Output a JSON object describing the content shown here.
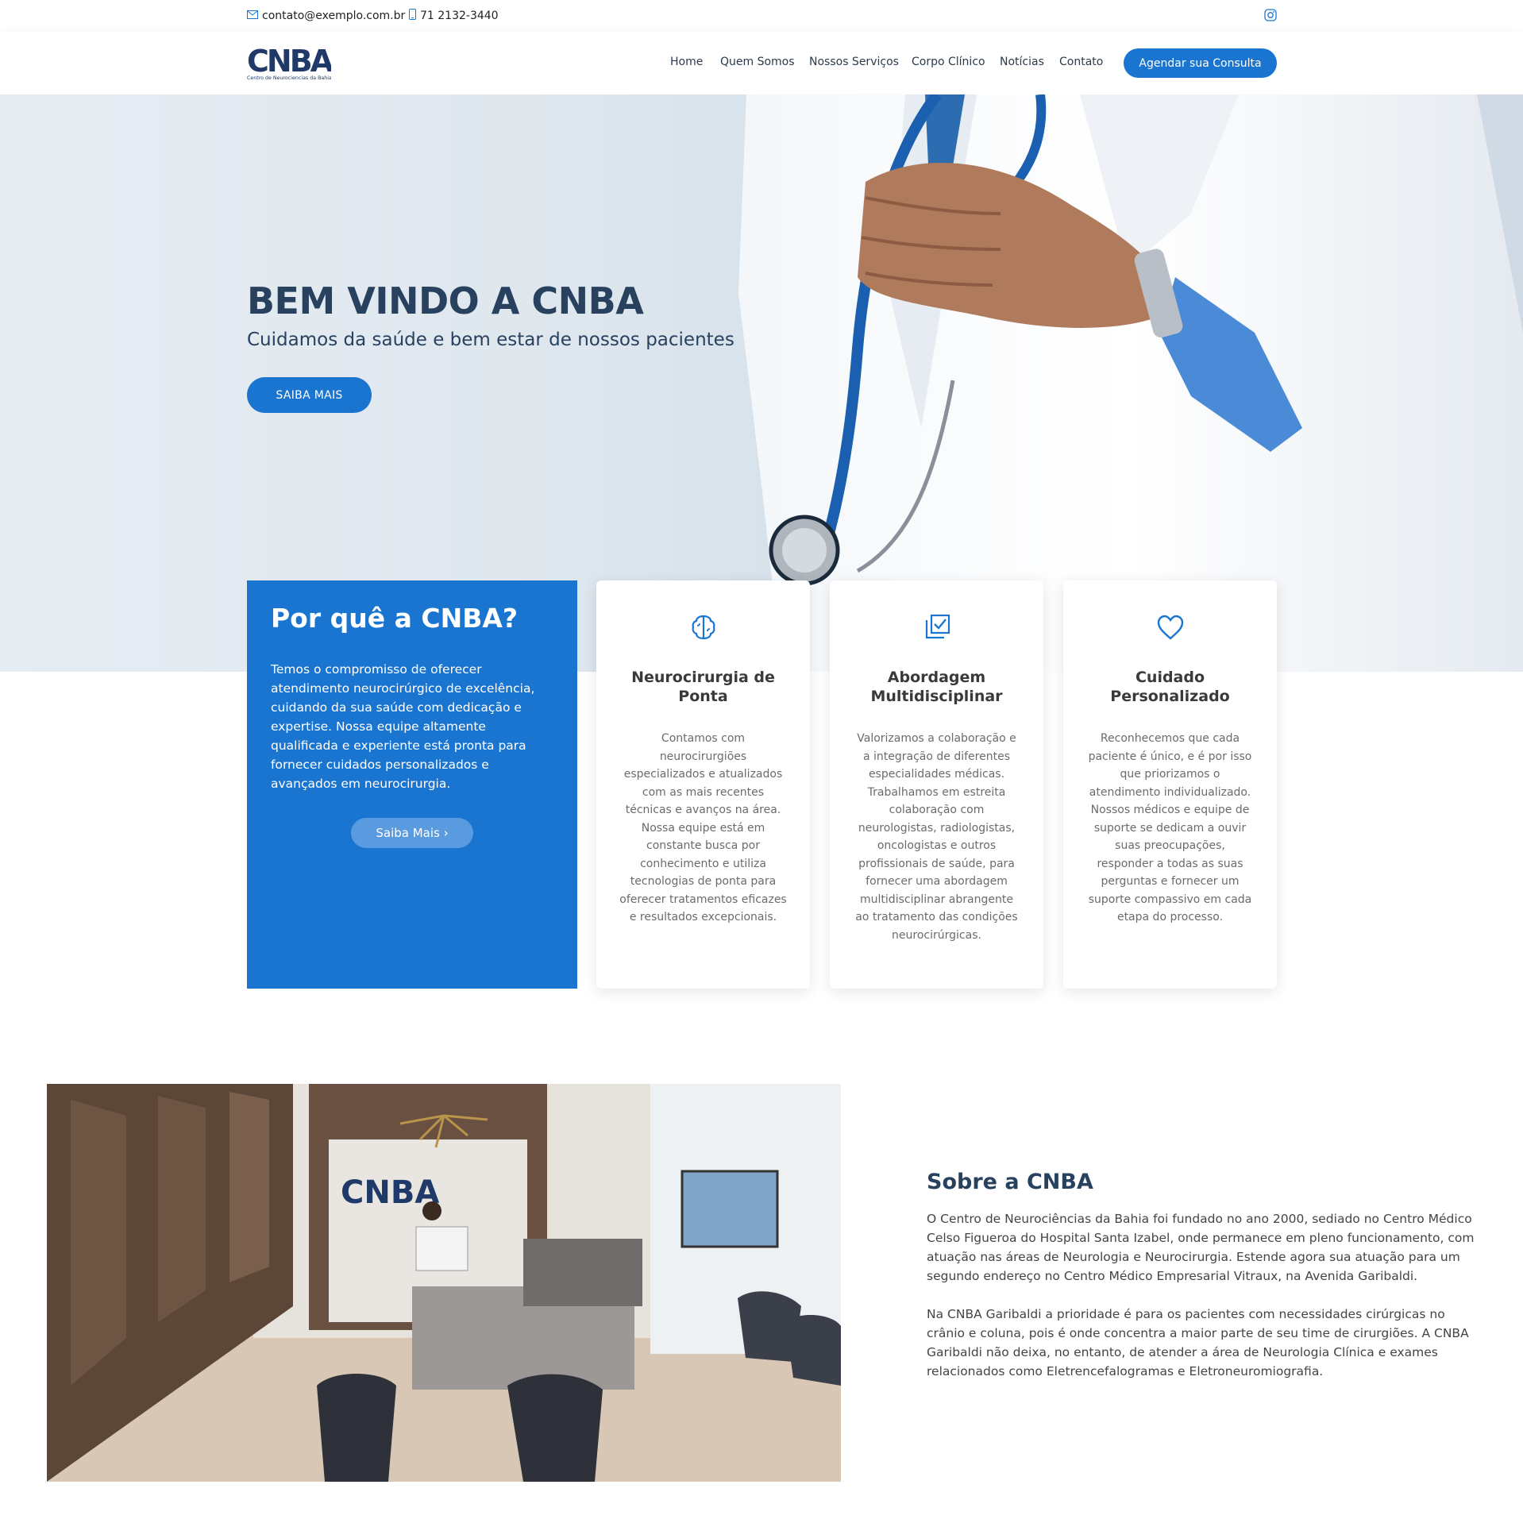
{
  "topbar": {
    "email": "contato@exemplo.com.br",
    "phone": "71 2132-3440"
  },
  "brand": {
    "logo_text": "CNBA",
    "logo_tagline": "Centro de Neurociencias da Bahia",
    "primary_color": "#1a75d1",
    "dark_color": "#27415f"
  },
  "nav": {
    "items": [
      "Home",
      "Quem Somos",
      "Nossos Serviços",
      "Corpo Clínico",
      "Notícias",
      "Contato"
    ],
    "cta": "Agendar sua Consulta"
  },
  "hero": {
    "title": "BEM VINDO A CNBA",
    "subtitle": "Cuidamos da saúde e bem estar de nossos pacientes",
    "button": "SAIBA MAIS"
  },
  "why": {
    "title": "Por quê a CNBA?",
    "text": "Temos o compromisso de oferecer atendimento neurocirúrgico de excelência, cuidando da sua saúde com dedicação e expertise. Nossa equipe altamente qualificada e experiente está pronta para fornecer cuidados personalizados e avançados em neurocirurgia.",
    "button": "Saiba Mais ›"
  },
  "cards": [
    {
      "icon": "brain-icon",
      "title": "Neurocirurgia de Ponta",
      "text": "Contamos com neurocirurgiões especializados e atualizados com as mais recentes técnicas e avanços na área. Nossa equipe está em constante busca por conhecimento e utiliza tecnologias de ponta para oferecer tratamentos eficazes e resultados excepcionais."
    },
    {
      "icon": "checklist-icon",
      "title": "Abordagem Multidisciplinar",
      "text": "Valorizamos a colaboração e a integração de diferentes especialidades médicas. Trabalhamos em estreita colaboração com neurologistas, radiologistas, oncologistas e outros profissionais de saúde, para fornecer uma abordagem multidisciplinar abrangente ao tratamento das condições neurocirúrgicas."
    },
    {
      "icon": "heart-icon",
      "title": "Cuidado Personalizado",
      "text": "Reconhecemos que cada paciente é único, e é por isso que priorizamos o atendimento individualizado. Nossos médicos e equipe de suporte se dedicam a ouvir suas preocupações, responder a todas as suas perguntas e fornecer um suporte compassivo em cada etapa do processo."
    }
  ],
  "about": {
    "title": "Sobre a CNBA",
    "paragraph1": "O Centro de Neurociências da Bahia foi fundado no ano 2000, sediado no Centro Médico Celso Figueroa do Hospital Santa Izabel, onde permanece em pleno funcionamento, com atuação nas áreas de Neurologia e Neurocirurgia. Estende agora sua atuação para um segundo endereço no Centro Médico Empresarial Vitraux, na Avenida Garibaldi.",
    "paragraph2": "Na CNBA Garibaldi a prioridade é para os pacientes com necessidades cirúrgicas no crânio e coluna, pois é onde concentra a maior parte de seu time de cirurgiões. A CNBA Garibaldi não deixa, no entanto, de atender a área de Neurologia Clínica e exames relacionados como Eletrencefalogramas e Eletroneuromiografia."
  }
}
